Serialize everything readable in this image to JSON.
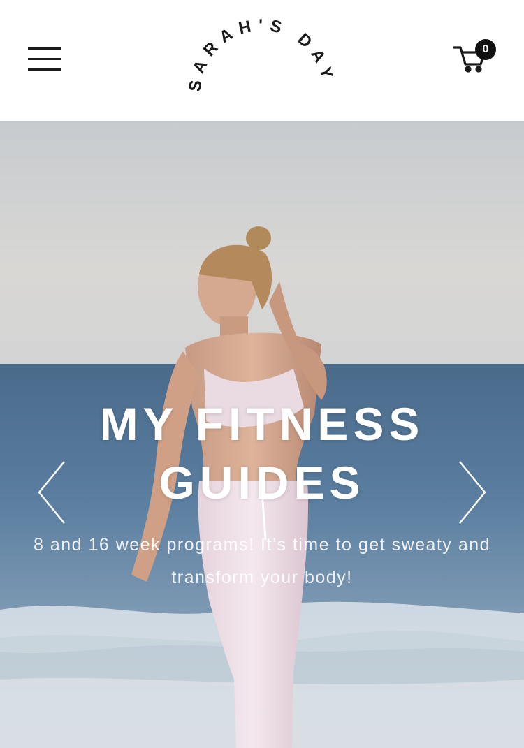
{
  "header": {
    "logo_text": "SARAH'S DAY",
    "cart": {
      "count": "0"
    }
  },
  "hero": {
    "title_line1": "MY FITNESS",
    "title_line2": "GUIDES",
    "subtitle": "8 and 16 week programs! It’s time to get sweaty and transform your body!",
    "prev_icon": "chevron-left-icon",
    "next_icon": "chevron-right-icon"
  },
  "colors": {
    "header_bg": "#ffffff",
    "text_dark": "#1a1a1a",
    "hero_text": "#ffffff",
    "badge_bg": "#111111"
  }
}
